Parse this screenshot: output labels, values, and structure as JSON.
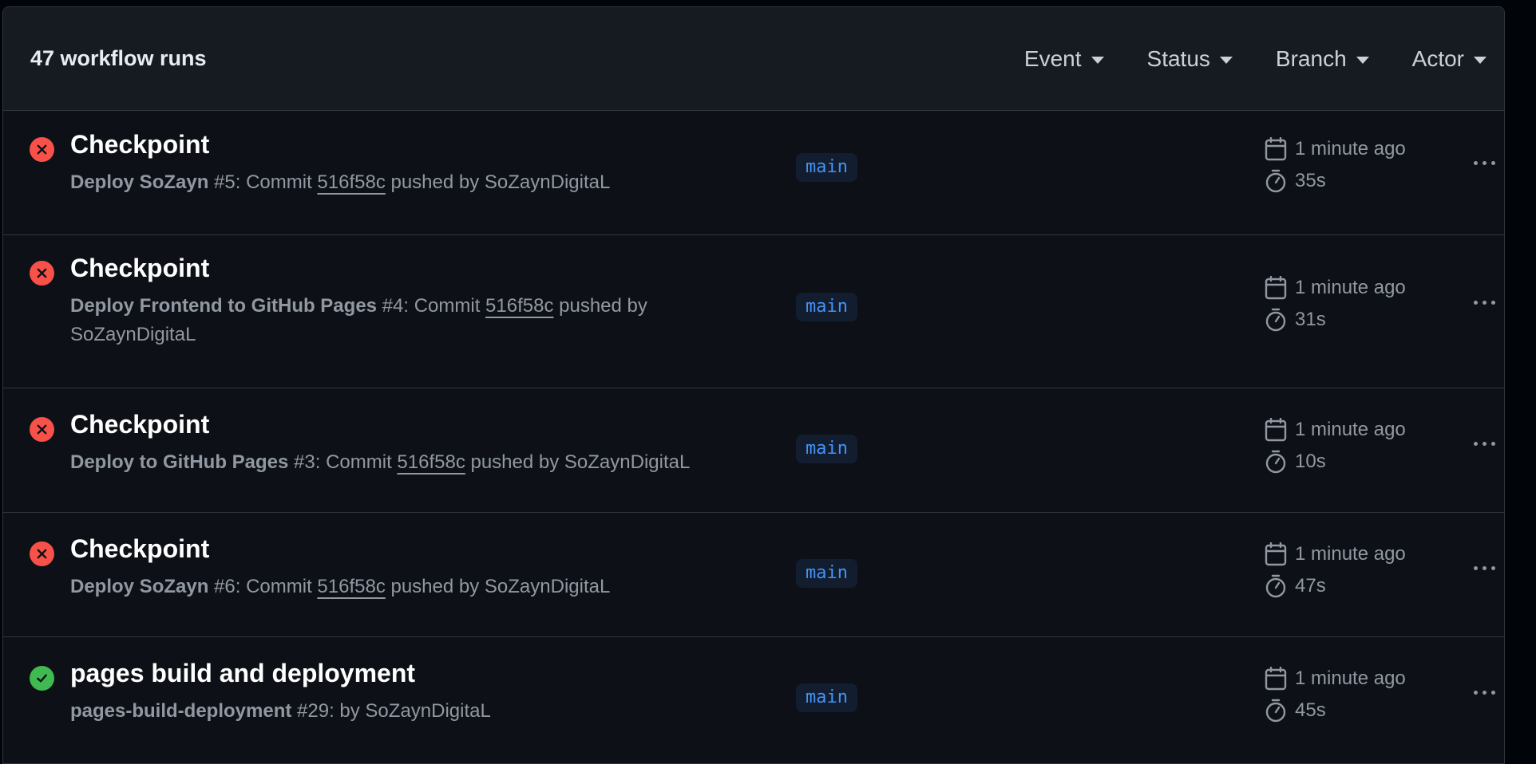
{
  "header": {
    "run_count": "47 workflow runs",
    "filters": [
      {
        "label": "Event"
      },
      {
        "label": "Status"
      },
      {
        "label": "Branch"
      },
      {
        "label": "Actor"
      }
    ]
  },
  "runs": [
    {
      "status": "failure",
      "status_icon": "x-circle-icon",
      "title": "Checkpoint",
      "workflow": "Deploy SoZayn",
      "number": " #5: Commit ",
      "sha": "516f58c",
      "tail": " pushed by SoZaynDigitaL",
      "branch": "main",
      "time_ago": "1 minute ago",
      "duration": "35s"
    },
    {
      "status": "failure",
      "status_icon": "x-circle-icon",
      "title": "Checkpoint",
      "workflow": "Deploy Frontend to GitHub Pages",
      "number": " #4: Commit ",
      "sha": "516f58c",
      "tail": " pushed by SoZaynDigitaL",
      "branch": "main",
      "time_ago": "1 minute ago",
      "duration": "31s"
    },
    {
      "status": "failure",
      "status_icon": "x-circle-icon",
      "title": "Checkpoint",
      "workflow": "Deploy to GitHub Pages",
      "number": " #3: Commit ",
      "sha": "516f58c",
      "tail": " pushed by SoZaynDigitaL",
      "branch": "main",
      "time_ago": "1 minute ago",
      "duration": "10s"
    },
    {
      "status": "failure",
      "status_icon": "x-circle-icon",
      "title": "Checkpoint",
      "workflow": "Deploy SoZayn",
      "number": " #6: Commit ",
      "sha": "516f58c",
      "tail": " pushed by SoZaynDigitaL",
      "branch": "main",
      "time_ago": "1 minute ago",
      "duration": "47s"
    },
    {
      "status": "success",
      "status_icon": "check-circle-icon",
      "title": "pages build and deployment",
      "workflow": "pages-build-deployment",
      "number": " #29: by SoZaynDigitaL",
      "sha": "",
      "tail": "",
      "branch": "main",
      "time_ago": "1 minute ago",
      "duration": "45s"
    }
  ],
  "colors": {
    "failure": "#f85149",
    "success": "#3fb950",
    "branch_text": "#4493f8",
    "branch_bg": "#121d2f"
  }
}
